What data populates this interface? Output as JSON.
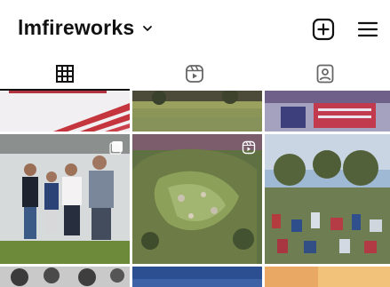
{
  "profile": {
    "username": "lmfireworks"
  },
  "header": {
    "username_dropdown_icon": "chevron-down-icon",
    "create_icon": "plus-square-icon",
    "menu_icon": "hamburger-menu-icon"
  },
  "tabs": [
    {
      "icon": "grid-icon",
      "selected": true
    },
    {
      "icon": "reels-icon",
      "selected": false
    },
    {
      "icon": "tagged-icon",
      "selected": false
    }
  ],
  "grid": {
    "posts": [
      {
        "badge": "none"
      },
      {
        "badge": "none"
      },
      {
        "badge": "none"
      },
      {
        "badge": "carousel-icon"
      },
      {
        "badge": "reels-icon"
      },
      {
        "badge": "none"
      },
      {
        "badge": "none"
      },
      {
        "badge": "none"
      },
      {
        "badge": "none"
      }
    ]
  }
}
